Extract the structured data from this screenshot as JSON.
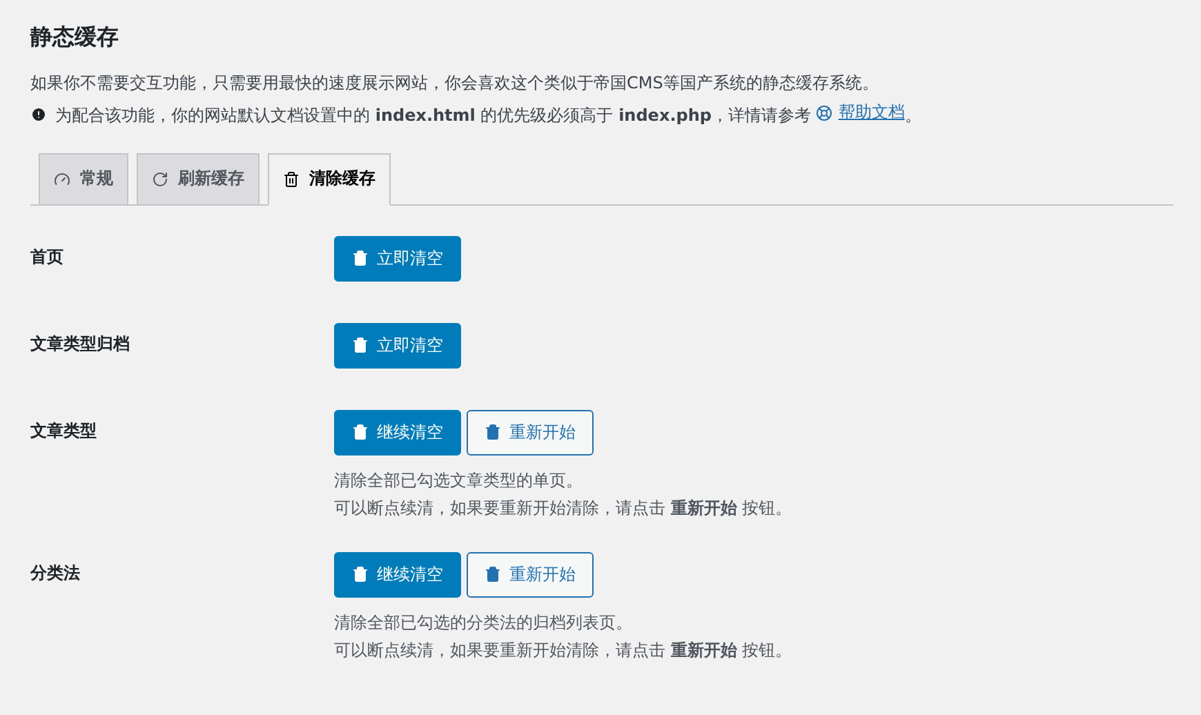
{
  "title": "静态缓存",
  "intro": "如果你不需要交互功能，只需要用最快的速度展示网站，你会喜欢这个类似于帝国CMS等国产系统的静态缓存系统。",
  "note": {
    "text": "为配合该功能，你的网站默认文档设置中的 **index.html** 的优先级必须高于 **index.php**，详情请参考",
    "link": "帮助文档",
    "after": "。"
  },
  "tabs": [
    {
      "label": "常规",
      "kind": "gauge",
      "selected": false
    },
    {
      "label": "刷新缓存",
      "kind": "refresh",
      "selected": false
    },
    {
      "label": "清除缓存",
      "kind": "trash",
      "selected": true
    }
  ],
  "rows": [
    {
      "label": "首页",
      "buttons": [
        {
          "label": "立即清空",
          "kind": "primary"
        }
      ]
    },
    {
      "label": "文章类型归档",
      "buttons": [
        {
          "label": "立即清空",
          "kind": "primary"
        }
      ]
    },
    {
      "label": "文章类型",
      "buttons": [
        {
          "label": "继续清空",
          "kind": "primary"
        },
        {
          "label": "重新开始",
          "kind": "secondary"
        }
      ],
      "help": [
        "清除全部已勾选文章类型的单页。",
        "可以断点续清，如果要重新开始清除，请点击 **重新开始** 按钮。"
      ]
    },
    {
      "label": "分类法",
      "buttons": [
        {
          "label": "继续清空",
          "kind": "primary"
        },
        {
          "label": "重新开始",
          "kind": "secondary"
        }
      ],
      "help": [
        "清除全部已勾选的分类法的归档列表页。",
        "可以断点续清，如果要重新开始清除，请点击 **重新开始** 按钮。"
      ]
    }
  ]
}
